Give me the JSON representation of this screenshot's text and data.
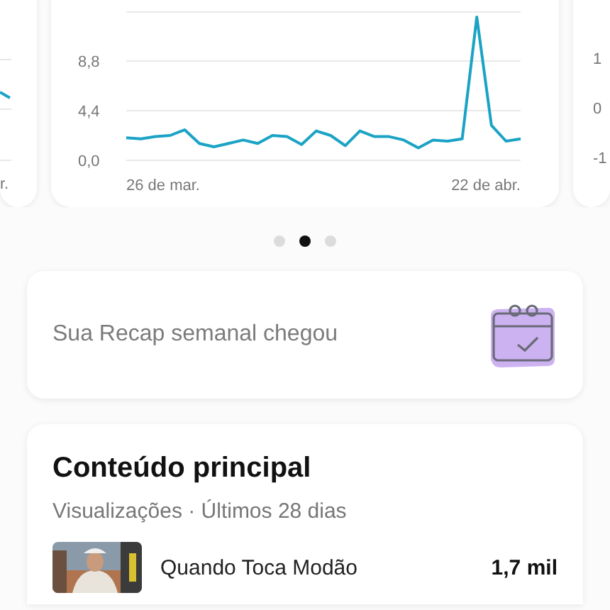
{
  "carousel": {
    "cards": [
      {
        "kind": "partial_left",
        "x_label": "r."
      },
      {
        "kind": "chart",
        "x_labels": [
          "26 de mar.",
          "22 de abr."
        ],
        "chart_data": {
          "type": "line",
          "ylim": [
            0,
            13.2
          ],
          "yticks": [
            {
              "value": 0,
              "label": "0,0"
            },
            {
              "value": 4.4,
              "label": "4,4"
            },
            {
              "value": 8.8,
              "label": "8,8"
            }
          ],
          "series": [
            {
              "color": "#1ba3c6",
              "values": [
                2.0,
                1.9,
                2.1,
                2.2,
                2.7,
                1.5,
                1.2,
                1.5,
                1.8,
                1.5,
                2.2,
                2.1,
                1.4,
                2.6,
                2.2,
                1.3,
                2.6,
                2.1,
                2.1,
                1.8,
                1.1,
                1.8,
                1.7,
                1.9,
                12.7,
                3.1,
                1.7,
                1.9
              ]
            }
          ]
        }
      },
      {
        "kind": "partial_right",
        "y_labels": [
          "1",
          "0",
          "-1"
        ]
      }
    ],
    "pages": [
      {
        "selected": false
      },
      {
        "selected": true
      },
      {
        "selected": false
      }
    ]
  },
  "recap": {
    "text": "Sua Recap semanal chegou"
  },
  "top_content": {
    "title": "Conteúdo principal",
    "subtitle": "Visualizações · Últimos 28 dias",
    "items": [
      {
        "title": "Quando Toca Modão",
        "value": "1,7 mil"
      }
    ]
  }
}
